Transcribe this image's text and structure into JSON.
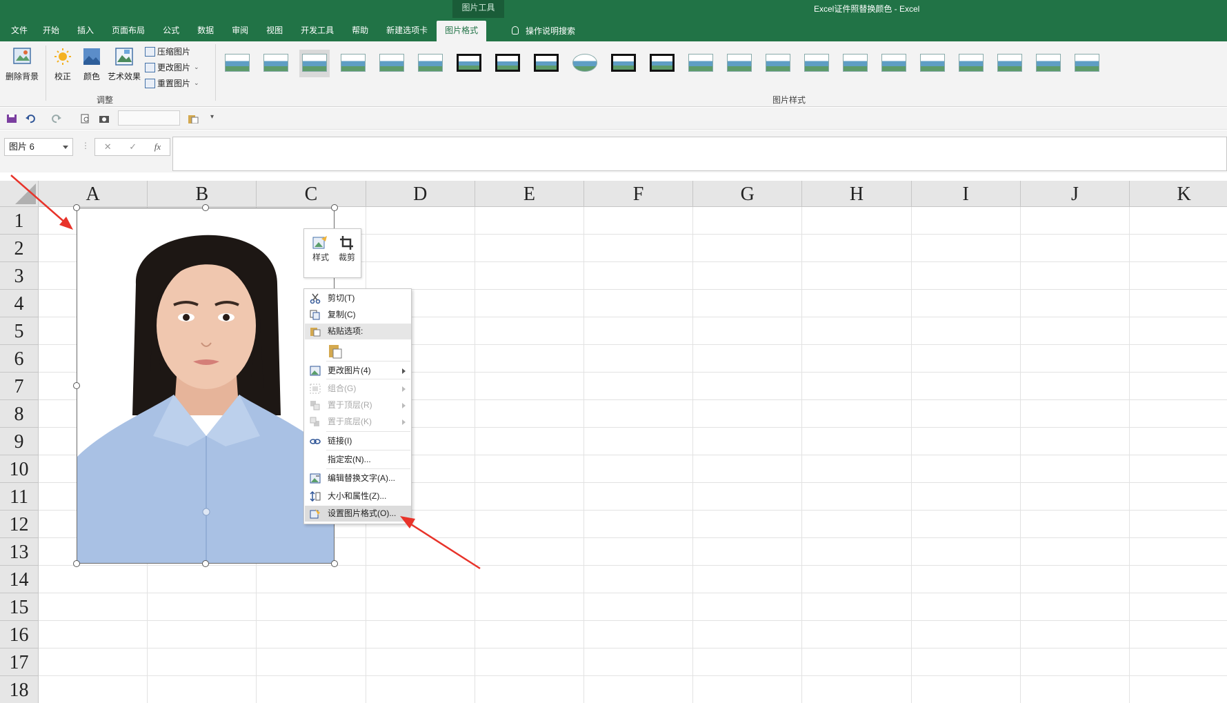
{
  "window": {
    "title": "Excel证件照替换颜色  -  Excel",
    "context_label": "图片工具"
  },
  "tabs": [
    "文件",
    "开始",
    "插入",
    "页面布局",
    "公式",
    "数据",
    "审阅",
    "视图",
    "开发工具",
    "帮助",
    "新建选项卡",
    "图片格式"
  ],
  "active_tab": "图片格式",
  "tell_me": "操作说明搜索",
  "ribbon": {
    "remove_bg": "删除背景",
    "corrections": "校正",
    "color": "颜色",
    "artistic": "艺术效果",
    "compress": "压缩图片",
    "change_picture": "更改图片",
    "reset_picture": "重置图片",
    "group_adjust": "调整",
    "group_styles": "图片样式",
    "style_count": 23
  },
  "formula_bar": {
    "name_box": "图片 6",
    "cancel": "✕",
    "enter": "✓",
    "fx": "fx",
    "formula": ""
  },
  "sheet": {
    "columns": [
      "A",
      "B",
      "C",
      "D",
      "E",
      "F",
      "G",
      "H",
      "I",
      "J",
      "K"
    ],
    "rows": [
      "1",
      "2",
      "3",
      "4",
      "5",
      "6",
      "7",
      "8",
      "9",
      "10",
      "11",
      "12",
      "13",
      "14",
      "15",
      "16",
      "17",
      "18"
    ]
  },
  "mini_toolbar": {
    "style": "样式",
    "crop": "裁剪"
  },
  "context_menu": {
    "items": [
      {
        "label": "剪切(T)",
        "icon": "scissors-icon",
        "enabled": true
      },
      {
        "label": "复制(C)",
        "icon": "copy-icon",
        "enabled": true
      },
      {
        "label": "粘贴选项:",
        "icon": "paste-icon",
        "enabled": true
      },
      {
        "label": "更改图片(4)",
        "icon": "change-picture-icon",
        "enabled": true,
        "submenu": true
      },
      {
        "label": "组合(G)",
        "icon": "group-icon",
        "enabled": false,
        "submenu": true
      },
      {
        "label": "置于顶层(R)",
        "icon": "bring-front-icon",
        "enabled": false,
        "submenu": true
      },
      {
        "label": "置于底层(K)",
        "icon": "send-back-icon",
        "enabled": false,
        "submenu": true
      },
      {
        "label": "链接(I)",
        "icon": "link-icon",
        "enabled": true
      },
      {
        "label": "指定宏(N)...",
        "icon": "",
        "enabled": true
      },
      {
        "label": "编辑替换文字(A)...",
        "icon": "alt-text-icon",
        "enabled": true
      },
      {
        "label": "大小和属性(Z)...",
        "icon": "size-icon",
        "enabled": true
      },
      {
        "label": "设置图片格式(O)...",
        "icon": "format-picture-icon",
        "enabled": true,
        "highlighted": true
      }
    ]
  },
  "colors": {
    "excel_green": "#217346",
    "annotation_red": "#e8332a",
    "shirt_blue": "#a9c1e4"
  }
}
